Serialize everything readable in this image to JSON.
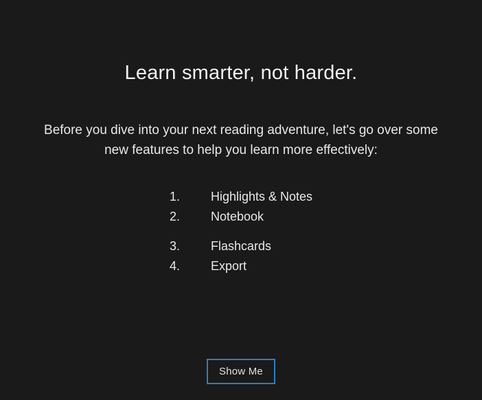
{
  "title": "Learn smarter, not harder.",
  "subtitle": "Before you dive into your next reading adventure, let's go over some new features to help you learn more effectively:",
  "features": [
    {
      "num": "1.",
      "label": "Highlights & Notes"
    },
    {
      "num": "2.",
      "label": "Notebook"
    },
    {
      "num": "3.",
      "label": "Flashcards"
    },
    {
      "num": "4.",
      "label": "Export"
    }
  ],
  "cta": {
    "label": "Show Me"
  },
  "colors": {
    "background": "#1a1a1a",
    "text": "#e8e8e8",
    "accent": "#2d7fc1"
  }
}
